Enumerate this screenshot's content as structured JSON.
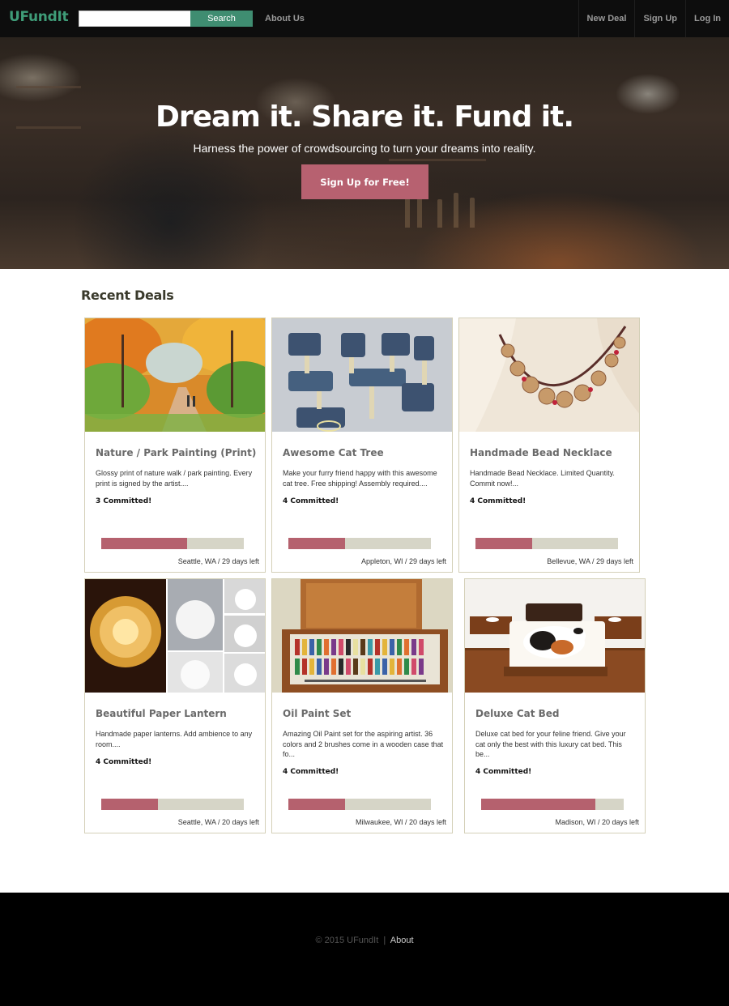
{
  "nav": {
    "brand": "UFundIt",
    "search_placeholder": "",
    "search_label": "Search",
    "about": "About Us",
    "new_deal": "New Deal",
    "sign_up": "Sign Up",
    "log_in": "Log In"
  },
  "hero": {
    "title": "Dream it. Share it. Fund it.",
    "subtitle": "Harness the power of crowdsourcing to turn your dreams into reality.",
    "cta": "Sign Up for Free!"
  },
  "section_title": "Recent Deals",
  "deals": [
    {
      "title": "Nature / Park Painting (Print)",
      "description": "Glossy print of nature walk / park painting. Every print is signed by the artist....",
      "committed": "3 Committed!",
      "progress": 0.6,
      "location": "Seattle, WA / 29 days left"
    },
    {
      "title": "Awesome Cat Tree",
      "description": "Make your furry friend happy with this awesome cat tree. Free shipping! Assembly required....",
      "committed": "4 Committed!",
      "progress": 0.4,
      "location": "Appleton, WI / 29 days left"
    },
    {
      "title": "Handmade Bead Necklace",
      "description": "Handmade Bead Necklace. Limited Quantity. Commit now!...",
      "committed": "4 Committed!",
      "progress": 0.4,
      "location": "Bellevue, WA / 29 days left"
    },
    {
      "title": "Beautiful Paper Lantern",
      "description": "Handmade paper lanterns. Add ambience to any room....",
      "committed": "4 Committed!",
      "progress": 0.4,
      "location": "Seattle, WA / 20 days left"
    },
    {
      "title": "Oil Paint Set",
      "description": "Amazing Oil Paint set for the aspiring artist. 36 colors and 2 brushes come in a wooden case that fo...",
      "committed": "4 Committed!",
      "progress": 0.4,
      "location": "Milwaukee, WI / 20 days left"
    },
    {
      "title": "Deluxe Cat Bed",
      "description": "Deluxe cat bed for your feline friend. Give your cat only the best with this luxury cat bed. This be...",
      "committed": "4 Committed!",
      "progress": 0.8,
      "location": "Madison, WI / 20 days left"
    }
  ],
  "footer": {
    "copyright": "© 2015 UFundIt",
    "separator": "|",
    "about": "About"
  },
  "colors": {
    "brand": "#3f9c78",
    "search_button": "#3f8d71",
    "cta": "#b76170",
    "progress_fill": "#b5616e",
    "progress_track": "#d6d5c7"
  }
}
